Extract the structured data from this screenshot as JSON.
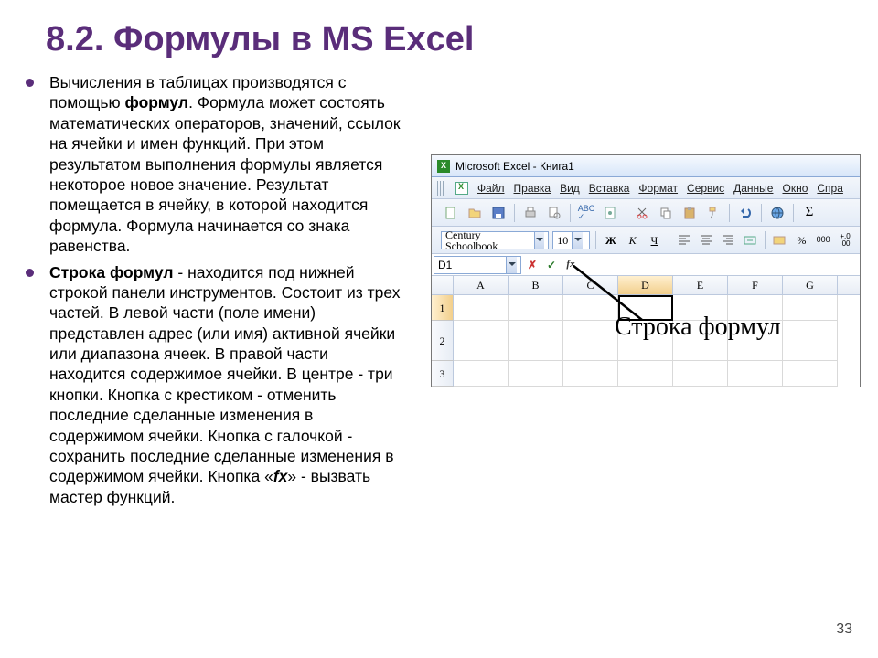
{
  "slide": {
    "title": "8.2. Формулы в MS Excel",
    "page_number": "33"
  },
  "paragraphs": {
    "p1_a": "Вычисления в таблицах производятся с помощью ",
    "p1_b_bold": "формул",
    "p1_c": ". Формула может состоять математических операторов, значений, ссылок на ячейки и имен функций. При этом результатом выполнения формулы является некоторое новое значение. Результат помещается в ячейку, в которой находится формула. Формула начинается со знака равенства.",
    "p2_a_bold": "Строка формул",
    "p2_b": " - находится под нижней строкой панели инструментов. Состоит из трех частей. В левой части (поле имени) представлен адрес (или имя) активной ячейки или диапазона ячеек. В правой части находится содержимое ячейки. В центре - три кнопки. Кнопка с крестиком - отменить последние сделанные изменения в содержимом ячейки. Кнопка с галочкой - сохранить последние сделанные изменения в содержимом ячейки. Кнопка «",
    "p2_c_bolditalic": "fx",
    "p2_d": "» - вызвать мастер функций."
  },
  "excel": {
    "title": "Microsoft Excel - Книга1",
    "menus": [
      "Файл",
      "Правка",
      "Вид",
      "Вставка",
      "Формат",
      "Сервис",
      "Данные",
      "Окно",
      "Спра"
    ],
    "font_name": "Century Schoolbook",
    "font_size": "10",
    "name_box": "D1",
    "fb_cancel": "✗",
    "fb_confirm": "✓",
    "fb_fx": "fx",
    "columns": [
      "A",
      "B",
      "C",
      "D",
      "E",
      "F",
      "G"
    ],
    "rows": [
      "1",
      "2",
      "3"
    ],
    "sigma": "Σ",
    "annotation": "Строка формул"
  }
}
